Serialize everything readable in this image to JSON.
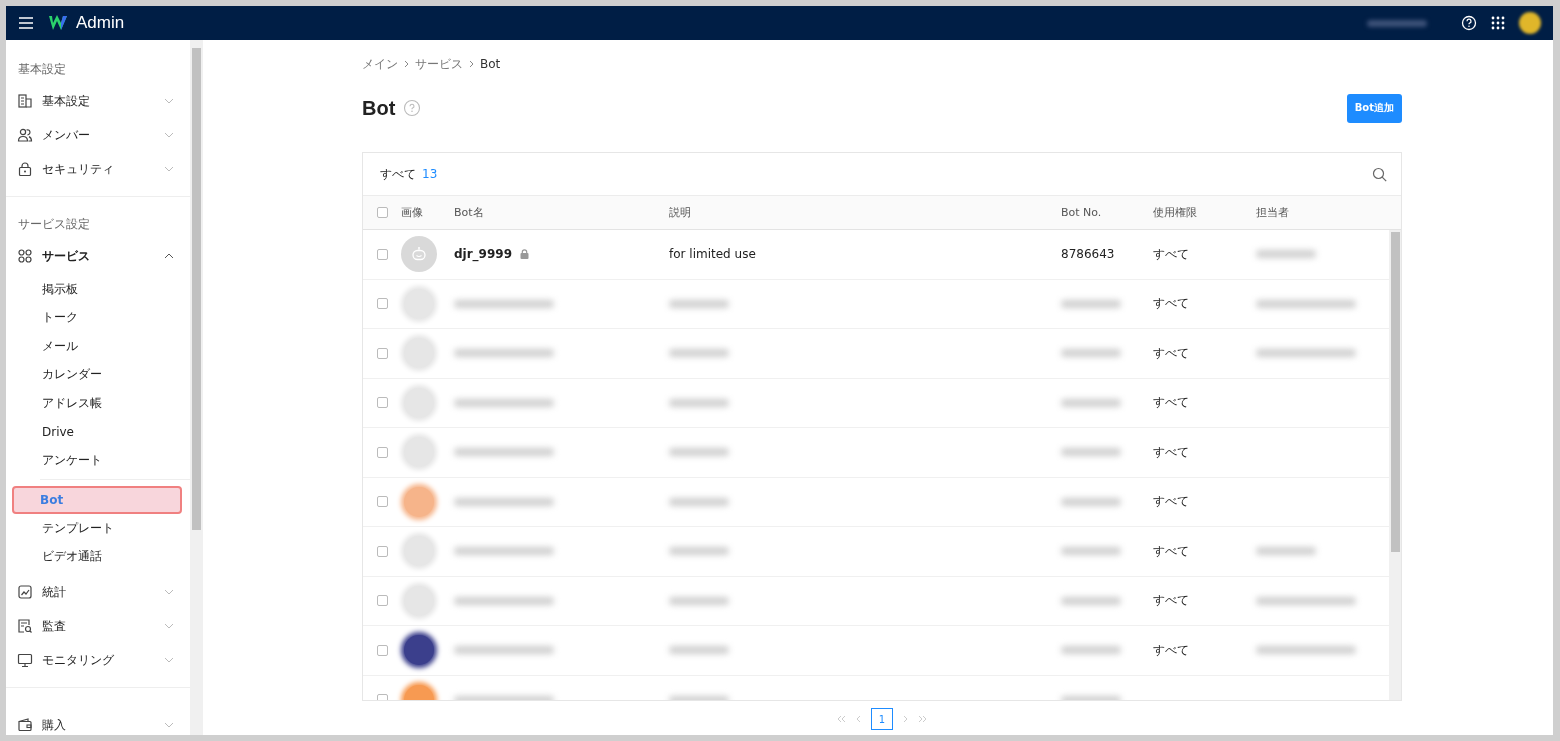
{
  "header": {
    "app_name": "Admin"
  },
  "sidebar": {
    "sections": [
      {
        "label": "基本設定",
        "items": [
          {
            "label": "基本設定",
            "expanded": false
          },
          {
            "label": "メンバー",
            "expanded": false
          },
          {
            "label": "セキュリティ",
            "expanded": false
          }
        ]
      },
      {
        "label": "サービス設定",
        "items": [
          {
            "label": "サービス",
            "expanded": true,
            "child_groups": [
              [
                {
                  "label": "掲示板",
                  "selected": false
                },
                {
                  "label": "トーク",
                  "selected": false
                },
                {
                  "label": "メール",
                  "selected": false
                },
                {
                  "label": "カレンダー",
                  "selected": false
                },
                {
                  "label": "アドレス帳",
                  "selected": false
                },
                {
                  "label": "Drive",
                  "selected": false
                },
                {
                  "label": "アンケート",
                  "selected": false
                }
              ],
              [
                {
                  "label": "Bot",
                  "selected": true
                },
                {
                  "label": "テンプレート",
                  "selected": false
                },
                {
                  "label": "ビデオ通話",
                  "selected": false
                }
              ]
            ]
          },
          {
            "label": "統計",
            "expanded": false
          },
          {
            "label": "監査",
            "expanded": false
          },
          {
            "label": "モニタリング",
            "expanded": false
          }
        ]
      },
      {
        "items": [
          {
            "label": "購入",
            "expanded": false
          }
        ]
      }
    ]
  },
  "breadcrumb": [
    "メイン",
    "サービス",
    "Bot"
  ],
  "title": "Bot",
  "add_button": "Bot追加",
  "table": {
    "filter_label": "すべて",
    "count": "13",
    "select_all_checked": false,
    "columns": [
      "画像",
      "Bot名",
      "説明",
      "Bot No.",
      "使用権限",
      "担当者"
    ],
    "rows": [
      {
        "checked": false,
        "redacted": false,
        "color": "#d9d9d9",
        "name": "djr_9999",
        "locked": true,
        "description": "for limited use",
        "bot_no": "8786643",
        "permission": "すべて",
        "owner_redacted": true
      },
      {
        "checked": false,
        "redacted": true,
        "color": "#e6e6e6",
        "permission": "すべて",
        "owner_redacted": true
      },
      {
        "checked": false,
        "redacted": true,
        "color": "#e6e6e6",
        "permission": "すべて",
        "owner_redacted": true
      },
      {
        "checked": false,
        "redacted": true,
        "color": "#e6e6e6",
        "permission": "すべて",
        "owner_redacted": false
      },
      {
        "checked": false,
        "redacted": true,
        "color": "#e6e6e6",
        "permission": "すべて",
        "owner_redacted": false
      },
      {
        "checked": false,
        "redacted": true,
        "color": "#f6b48a",
        "permission": "すべて",
        "owner_redacted": false
      },
      {
        "checked": false,
        "redacted": true,
        "color": "#e6e6e6",
        "permission": "すべて",
        "owner_redacted": true
      },
      {
        "checked": false,
        "redacted": true,
        "color": "#e6e6e6",
        "permission": "すべて",
        "owner_redacted": true
      },
      {
        "checked": false,
        "redacted": true,
        "color": "#3b3f8c",
        "permission": "すべて",
        "owner_redacted": true
      },
      {
        "checked": false,
        "redacted": true,
        "color": "#f79a52",
        "owner_redacted": false
      }
    ]
  },
  "pagination": {
    "pages": [
      {
        "label": "1",
        "selected": true
      }
    ]
  }
}
